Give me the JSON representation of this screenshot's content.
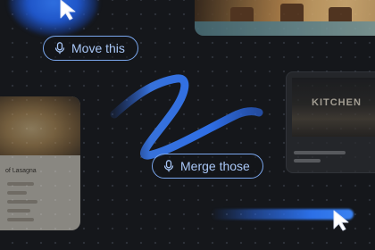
{
  "commands": [
    {
      "label": "Move this",
      "icon": "microphone-icon"
    },
    {
      "label": "Merge those",
      "icon": "microphone-icon"
    }
  ],
  "cards": {
    "recipe_card_title": "of Lasagna",
    "storefront_sign": "KITCHEN"
  },
  "icons": [
    "cursor-arrow-icon",
    "microphone-icon"
  ],
  "colors": {
    "background": "#15171b",
    "accent_blue": "#2c6fe6",
    "chip_border": "#7aa7ee",
    "chip_text": "#a9c7f7"
  }
}
